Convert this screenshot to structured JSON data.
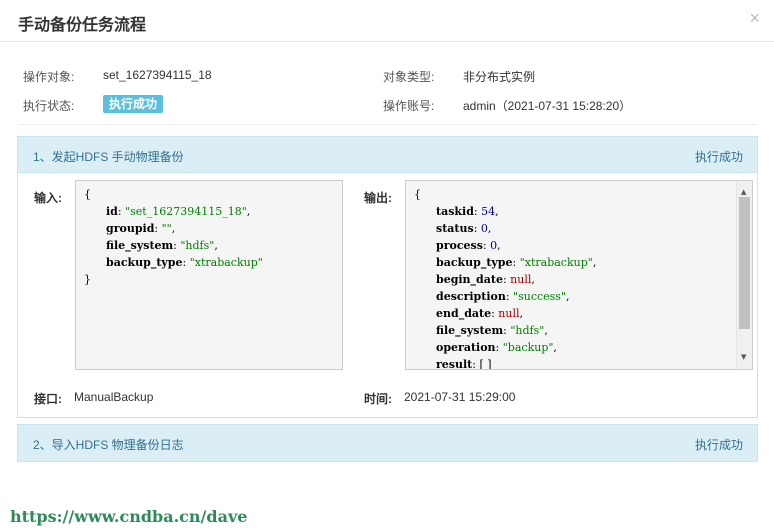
{
  "dialog": {
    "title": "手动备份任务流程",
    "close": "×"
  },
  "info": {
    "target_label": "操作对象:",
    "target_value": "set_1627394115_18",
    "type_label": "对象类型:",
    "type_value": "非分布式实例",
    "status_label": "执行状态:",
    "status_badge": "执行成功",
    "account_label": "操作账号:",
    "account_value": "admin（2021-07-31 15:28:20）"
  },
  "steps": [
    {
      "title": "1、发起HDFS 手动物理备份",
      "status": "执行成功",
      "input_label": "输入:",
      "output_label": "输出:",
      "input": {
        "open": "{",
        "close": "}",
        "fields": [
          {
            "key": "id",
            "value": "\"set_1627394115_18\"",
            "sep": ","
          },
          {
            "key": "groupid",
            "value": "\"\"",
            "sep": ","
          },
          {
            "key": "file_system",
            "value": "\"hdfs\"",
            "sep": ","
          },
          {
            "key": "backup_type",
            "value": "\"xtrabackup\"",
            "sep": ""
          }
        ]
      },
      "output": {
        "open": "{",
        "fields": [
          {
            "key": "taskid",
            "value": "54",
            "sep": ","
          },
          {
            "key": "status",
            "value": "0",
            "sep": ","
          },
          {
            "key": "process",
            "value": "0",
            "sep": ","
          },
          {
            "key": "backup_type",
            "value": "\"xtrabackup\"",
            "sep": ","
          },
          {
            "key": "begin_date",
            "value": "null",
            "sep": ","
          },
          {
            "key": "description",
            "value": "\"success\"",
            "sep": ","
          },
          {
            "key": "end_date",
            "value": "null",
            "sep": ","
          },
          {
            "key": "file_system",
            "value": "\"hdfs\"",
            "sep": ","
          },
          {
            "key": "operation",
            "value": "\"backup\"",
            "sep": ","
          },
          {
            "key": "result",
            "value": "[ ]",
            "sep": ""
          }
        ]
      },
      "interface_label": "接口:",
      "interface_value": "ManualBackup",
      "time_label": "时间:",
      "time_value": "2021-07-31 15:29:00"
    },
    {
      "title": "2、导入HDFS 物理备份日志",
      "status": "执行成功"
    }
  ],
  "watermark": "https://www.cndba.cn/dave"
}
